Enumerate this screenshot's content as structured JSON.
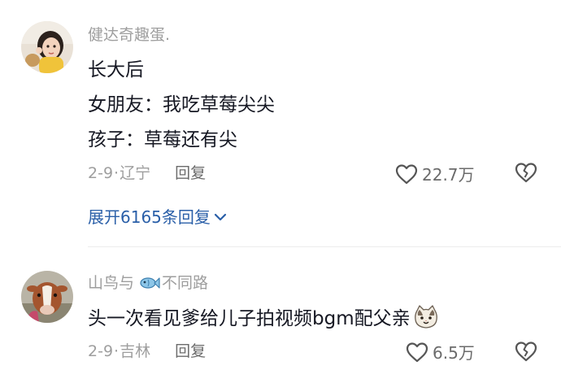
{
  "comments": [
    {
      "username": "健达奇趣蛋.",
      "lines": [
        "长大后",
        "女朋友：我吃草莓尖尖",
        "孩子：草莓还有尖"
      ],
      "date": "2-9",
      "location": "辽宁",
      "reply_label": "回复",
      "likes": "22.7万",
      "expand_label": "展开6165条回复"
    },
    {
      "username_part1": "山鸟与",
      "username_part2": "不同路",
      "lines": [
        "头一次看见爹给儿子拍视频bgm配父亲"
      ],
      "date": "2-9",
      "location": "吉林",
      "reply_label": "回复",
      "likes": "6.5万"
    }
  ],
  "separator": "·",
  "colors": {
    "text": "#161823",
    "meta": "#9e9e9e",
    "link": "#2a5fa8"
  },
  "icons": [
    "heart-icon",
    "broken-heart-icon",
    "chevron-down-icon",
    "fish-icon",
    "cat-emoji-icon"
  ]
}
